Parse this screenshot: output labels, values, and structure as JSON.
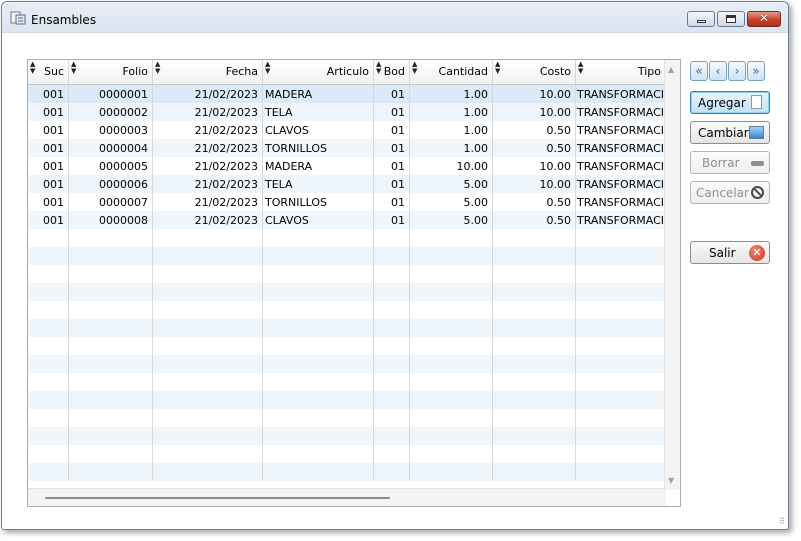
{
  "window": {
    "title": "Ensambles"
  },
  "grid": {
    "columns": [
      {
        "key": "suc",
        "label": "Suc"
      },
      {
        "key": "folio",
        "label": "Folio"
      },
      {
        "key": "fecha",
        "label": "Fecha"
      },
      {
        "key": "articulo",
        "label": "Articulo"
      },
      {
        "key": "bod",
        "label": "Bod"
      },
      {
        "key": "cantidad",
        "label": "Cantidad"
      },
      {
        "key": "costo",
        "label": "Costo"
      },
      {
        "key": "tipo",
        "label": "Tipo"
      }
    ],
    "rows": [
      {
        "suc": "001",
        "folio": "0000001",
        "fecha": "21/02/2023",
        "articulo": "MADERA",
        "bod": "01",
        "cantidad": "1.00",
        "costo": "10.00",
        "tipo": "TRANSFORMACION"
      },
      {
        "suc": "001",
        "folio": "0000002",
        "fecha": "21/02/2023",
        "articulo": "TELA",
        "bod": "01",
        "cantidad": "1.00",
        "costo": "10.00",
        "tipo": "TRANSFORMACION"
      },
      {
        "suc": "001",
        "folio": "0000003",
        "fecha": "21/02/2023",
        "articulo": "CLAVOS",
        "bod": "01",
        "cantidad": "1.00",
        "costo": "0.50",
        "tipo": "TRANSFORMACION"
      },
      {
        "suc": "001",
        "folio": "0000004",
        "fecha": "21/02/2023",
        "articulo": "TORNILLOS",
        "bod": "01",
        "cantidad": "1.00",
        "costo": "0.50",
        "tipo": "TRANSFORMACION"
      },
      {
        "suc": "001",
        "folio": "0000005",
        "fecha": "21/02/2023",
        "articulo": "MADERA",
        "bod": "01",
        "cantidad": "10.00",
        "costo": "10.00",
        "tipo": "TRANSFORMACION"
      },
      {
        "suc": "001",
        "folio": "0000006",
        "fecha": "21/02/2023",
        "articulo": "TELA",
        "bod": "01",
        "cantidad": "5.00",
        "costo": "10.00",
        "tipo": "TRANSFORMACION"
      },
      {
        "suc": "001",
        "folio": "0000007",
        "fecha": "21/02/2023",
        "articulo": "TORNILLOS",
        "bod": "01",
        "cantidad": "5.00",
        "costo": "0.50",
        "tipo": "TRANSFORMACION"
      },
      {
        "suc": "001",
        "folio": "0000008",
        "fecha": "21/02/2023",
        "articulo": "CLAVOS",
        "bod": "01",
        "cantidad": "5.00",
        "costo": "0.50",
        "tipo": "TRANSFORMACION"
      }
    ],
    "selected_row": 0
  },
  "nav": {
    "first": {
      "glyph": "«",
      "icon": "double-chevron-left-icon"
    },
    "prev": {
      "glyph": "‹",
      "icon": "chevron-left-icon"
    },
    "next": {
      "glyph": "›",
      "icon": "chevron-right-icon"
    },
    "last": {
      "glyph": "»",
      "icon": "double-chevron-right-icon"
    }
  },
  "actions": {
    "agregar": {
      "label": "Agregar",
      "icon": "new-document-icon",
      "enabled": true
    },
    "cambiar": {
      "label": "Cambiar",
      "icon": "edit-picture-icon",
      "enabled": true
    },
    "borrar": {
      "label": "Borrar",
      "icon": "delete-dash-icon",
      "enabled": false
    },
    "cancelar": {
      "label": "Cancelar",
      "icon": "cancel-icon",
      "enabled": false
    },
    "salir": {
      "label": "Salir",
      "icon": "exit-icon",
      "enabled": true
    }
  },
  "colors": {
    "selection": "#dbeaf8",
    "alt_row": "#eef6fc",
    "primary_button": "#bfe2f7",
    "exit_red": "#c43220"
  }
}
